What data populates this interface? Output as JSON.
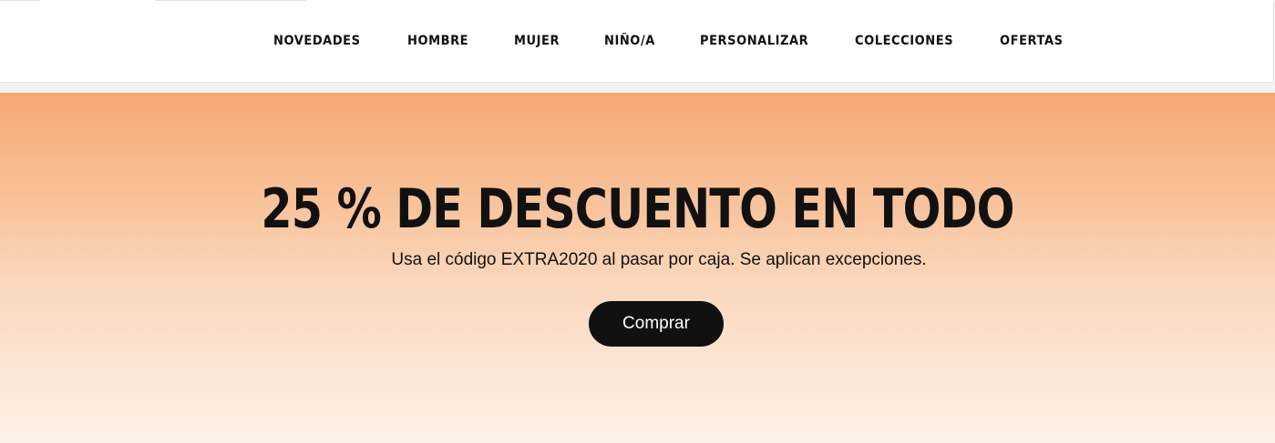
{
  "nav": {
    "items": [
      {
        "label": "NOVEDADES"
      },
      {
        "label": "HOMBRE"
      },
      {
        "label": "MUJER"
      },
      {
        "label": "NIÑO/A"
      },
      {
        "label": "PERSONALIZAR"
      },
      {
        "label": "COLECCIONES"
      },
      {
        "label": "OFERTAS"
      }
    ]
  },
  "hero": {
    "title": "25 % DE DESCUENTO EN TODO",
    "subtitle": "Usa el código EXTRA2020 al pasar por caja. Se aplican excepciones.",
    "cta_label": "Comprar",
    "gradient_top": "#f6a871",
    "gradient_bottom": "#fdf1e8"
  },
  "colors": {
    "text": "#111111",
    "button_bg": "#111111",
    "button_text": "#ffffff"
  }
}
